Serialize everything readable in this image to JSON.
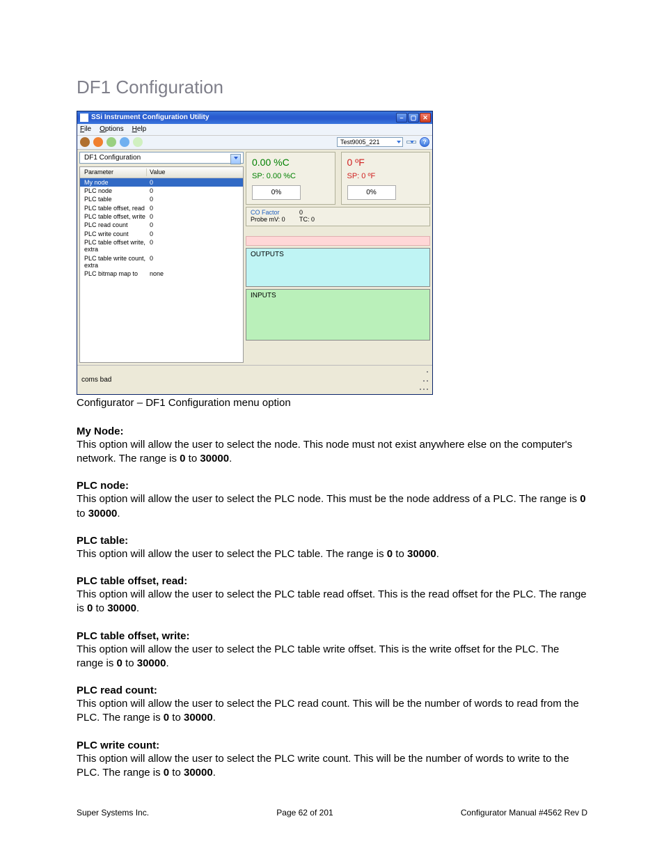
{
  "page_title": "DF1 Configuration",
  "window": {
    "title": "SSi Instrument Configuration Utility",
    "menus": {
      "file": "File",
      "options": "Options",
      "help": "Help"
    },
    "combo_main": "Test9005_221",
    "picker_label": "DF1 Configuration",
    "table_headers": {
      "param": "Parameter",
      "value": "Value"
    },
    "rows": [
      {
        "param": "My node",
        "value": "0"
      },
      {
        "param": "PLC node",
        "value": "0"
      },
      {
        "param": "PLC table",
        "value": "0"
      },
      {
        "param": "PLC table offset, read",
        "value": "0"
      },
      {
        "param": "PLC table offset, write",
        "value": "0"
      },
      {
        "param": "PLC read count",
        "value": "0"
      },
      {
        "param": "PLC write count",
        "value": "0"
      },
      {
        "param": "PLC table offset write, extra",
        "value": "0"
      },
      {
        "param": "PLC table write count, extra",
        "value": "0"
      },
      {
        "param": "PLC bitmap map to",
        "value": "none"
      }
    ],
    "readouts": {
      "left_big": "0.00 %C",
      "right_big": "0 ºF",
      "left_sp": "SP: 0.00 %C",
      "right_sp": "SP: 0 ºF",
      "left_pct": "0%",
      "right_pct": "0%"
    },
    "info": {
      "co_label": "CO Factor",
      "co_val": "0",
      "probe_label": "Probe mV: 0",
      "tc_label": "TC: 0"
    },
    "outputs_label": "OUTPUTS",
    "inputs_label": "INPUTS",
    "status": "coms bad"
  },
  "caption": "Configurator – DF1 Configuration menu option",
  "sections": [
    {
      "h": "My Node:",
      "body_a": "This option will allow the user to select the node.  This node must not exist anywhere else on the computer's network.  The range is ",
      "b1": "0",
      "mid": " to ",
      "b2": "30000",
      "end": "."
    },
    {
      "h": "PLC node:",
      "body_a": "This option will allow the user to select the PLC node.  This must be the node address of a PLC.  The range is ",
      "b1": "0",
      "mid": " to ",
      "b2": "30000",
      "end": "."
    },
    {
      "h": "PLC table:",
      "body_a": "This option will allow the user to select the PLC table.  The range is ",
      "b1": "0",
      "mid": " to ",
      "b2": "30000",
      "end": "."
    },
    {
      "h": "PLC table offset, read:",
      "body_a": "This option will allow the user to select the PLC table read offset.  This is the read offset for the PLC.  The range is ",
      "b1": "0",
      "mid": " to ",
      "b2": "30000",
      "end": "."
    },
    {
      "h": "PLC table offset, write:",
      "body_a": "This option will allow the user to select the PLC table write offset.  This is the write offset for the PLC.  The range is ",
      "b1": "0",
      "mid": " to ",
      "b2": "30000",
      "end": "."
    },
    {
      "h": "PLC read count:",
      "body_a": "This option will allow the user to select the PLC read count.  This will be the number of words to read from the PLC.  The range is ",
      "b1": "0",
      "mid": " to ",
      "b2": "30000",
      "end": "."
    },
    {
      "h": "PLC write count:",
      "body_a": "This option will allow the user to select the PLC write count.  This will be the number of words to write to the PLC.  The range is ",
      "b1": "0",
      "mid": " to ",
      "b2": "30000",
      "end": "."
    }
  ],
  "footer": {
    "left": "Super Systems Inc.",
    "center": "Page 62 of 201",
    "right": "Configurator Manual #4562 Rev D"
  }
}
